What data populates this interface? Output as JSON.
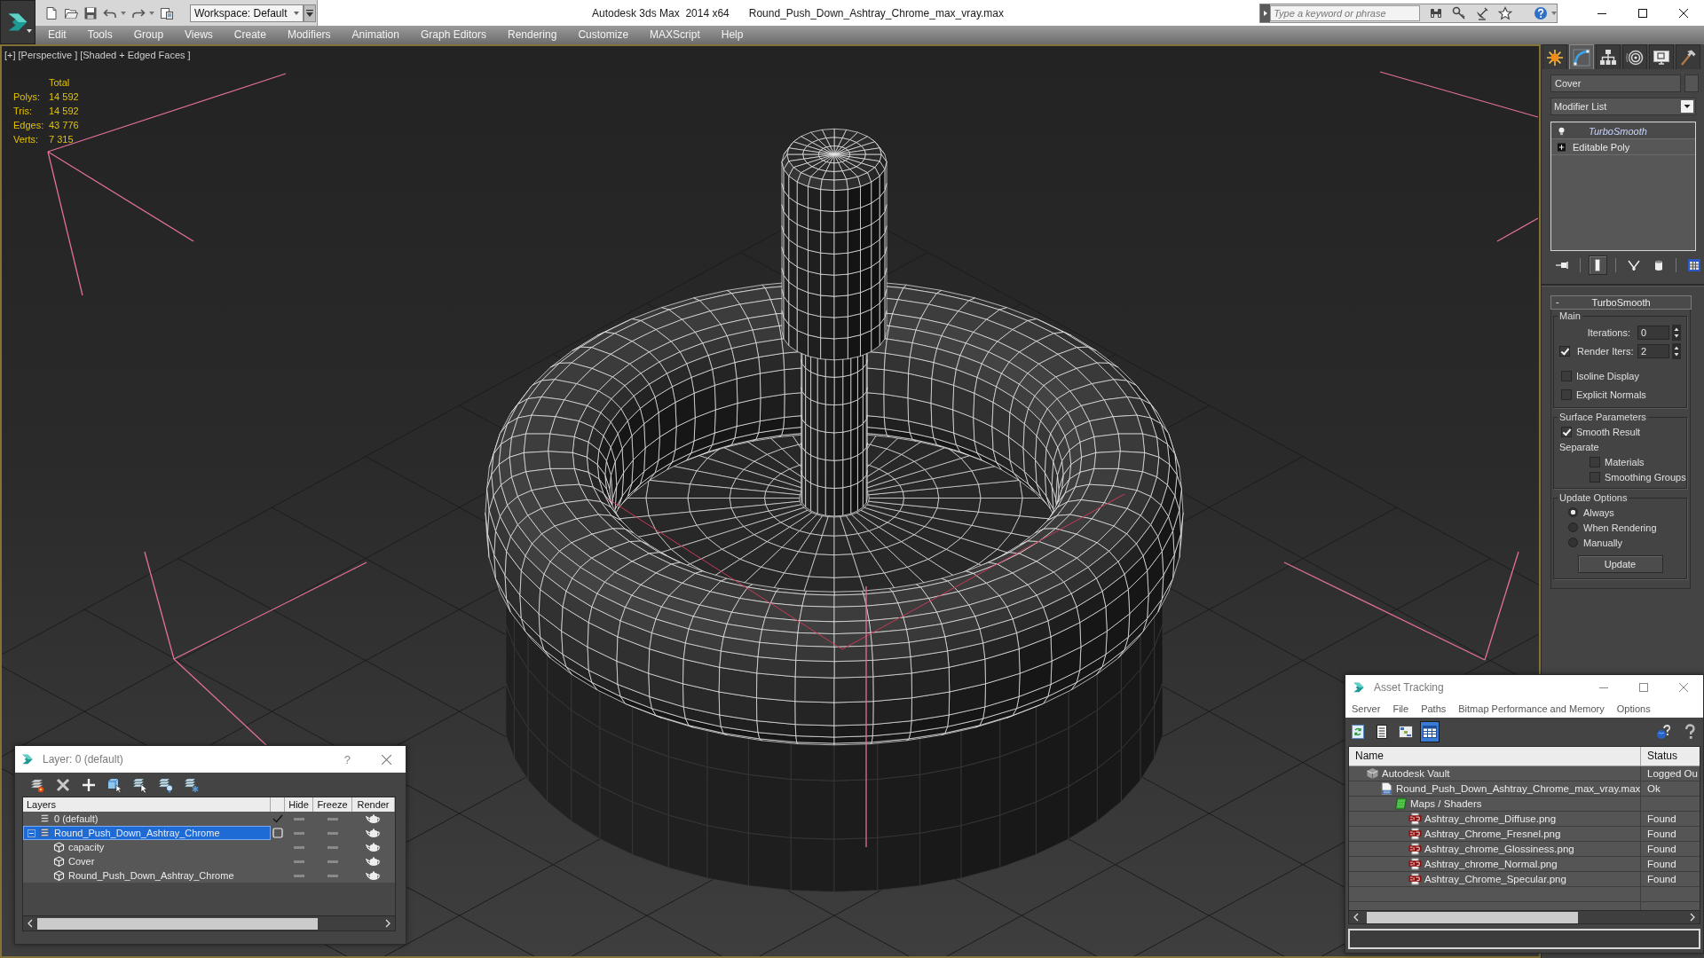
{
  "window": {
    "app_title": "Autodesk 3ds Max  2014 x64",
    "file_title": "Round_Push_Down_Ashtray_Chrome_max_vray.max"
  },
  "toolbar": {
    "workspace": "Workspace: Default"
  },
  "search": {
    "placeholder": "Type a keyword or phrase"
  },
  "menu": [
    "Edit",
    "Tools",
    "Group",
    "Views",
    "Create",
    "Modifiers",
    "Animation",
    "Graph Editors",
    "Rendering",
    "Customize",
    "MAXScript",
    "Help"
  ],
  "viewport": {
    "labels": [
      "[+]",
      "[Perspective ]",
      "[Shaded + Edged Faces ]"
    ],
    "stats": {
      "header": "Total",
      "rows": [
        {
          "label": "Polys:",
          "value": "14 592"
        },
        {
          "label": "Tris:",
          "value": "14 592"
        },
        {
          "label": "Edges:",
          "value": "43 776"
        },
        {
          "label": "Verts:",
          "value": "7 315"
        }
      ]
    }
  },
  "command_panel": {
    "tabs": [
      {
        "selected": false
      },
      {
        "selected": true
      },
      {
        "selected": false
      },
      {
        "selected": false
      },
      {
        "selected": false
      },
      {
        "selected": false
      }
    ],
    "object_name": "Cover",
    "modifier_list": "Modifier List",
    "stack": [
      {
        "kind": "modifier",
        "name": "TurboSmooth",
        "selected": true
      },
      {
        "kind": "object",
        "name": "Editable Poly",
        "selected": false
      }
    ],
    "stack_tools": [
      {
        "selected": false
      },
      {
        "selected": true
      },
      {
        "selected": false
      },
      {
        "selected": false
      },
      {
        "selected": false
      }
    ],
    "rollout": {
      "collapse_sign": "-",
      "title": "TurboSmooth",
      "groups": [
        {
          "title": "Main",
          "controls": [
            {
              "kind": "spinner",
              "label": "Iterations:",
              "value": "0"
            },
            {
              "kind": "checked_spinner",
              "label": "Render Iters:",
              "value": "2",
              "checked": true
            },
            {
              "kind": "checkbox",
              "label": "Isoline Display",
              "checked": false
            },
            {
              "kind": "checkbox",
              "label": "Explicit Normals",
              "checked": false
            }
          ]
        },
        {
          "title": "Surface Parameters",
          "controls": [
            {
              "kind": "checkbox",
              "label": "Smooth Result",
              "checked": true
            },
            {
              "kind": "label",
              "label": "Separate",
              "children": [
                {
                  "kind": "checkbox",
                  "label": "Materials",
                  "checked": false
                },
                {
                  "kind": "checkbox",
                  "label": "Smoothing Groups",
                  "checked": false
                }
              ]
            }
          ]
        },
        {
          "title": "Update Options",
          "controls": [
            {
              "kind": "radio",
              "label": "Always",
              "selected": true
            },
            {
              "kind": "radio",
              "label": "When Rendering",
              "selected": false
            },
            {
              "kind": "radio",
              "label": "Manually",
              "selected": false
            },
            {
              "kind": "button",
              "label": "Update"
            }
          ]
        }
      ]
    }
  },
  "layer_dialog": {
    "title": "Layer: 0 (default)",
    "help": "?",
    "columns": [
      "Layers",
      "Hide",
      "Freeze",
      "Render"
    ],
    "layers": [
      {
        "name": "0 (default)",
        "current": true,
        "selected": false,
        "hidden": false,
        "frozen": false,
        "renderable": true
      },
      {
        "name": "Round_Push_Down_Ashtray_Chrome",
        "current": false,
        "selected": true,
        "expanded": true,
        "hidden": false,
        "frozen": false,
        "renderable": true,
        "children": [
          {
            "name": "capacity",
            "selected": false,
            "hidden": false,
            "frozen": false,
            "renderable": true
          },
          {
            "name": "Cover",
            "selected": false,
            "hidden": false,
            "frozen": false,
            "renderable": true
          },
          {
            "name": "Round_Push_Down_Ashtray_Chrome",
            "selected": false,
            "hidden": false,
            "frozen": false,
            "renderable": true
          }
        ]
      }
    ]
  },
  "asset_tracking": {
    "title": "Asset Tracking",
    "menu": [
      "Server",
      "File",
      "Paths",
      "Bitmap Performance and Memory",
      "Options"
    ],
    "toolbar": [
      {
        "selected": false
      },
      {
        "selected": false
      },
      {
        "selected": false
      },
      {
        "selected": true
      }
    ],
    "columns": [
      "Name",
      "Status"
    ],
    "rows": [
      {
        "kind": "vault",
        "name": "Autodesk Vault",
        "status": "Logged Ou",
        "selected": false,
        "children": [
          {
            "kind": "scene",
            "name": "Round_Push_Down_Ashtray_Chrome_max_vray.max",
            "status": "Ok",
            "selected": false,
            "children": [
              {
                "kind": "folder",
                "name": "Maps / Shaders",
                "selected": false,
                "children": [
                  {
                    "kind": "bitmap",
                    "name": "Ashtray_chrome_Diffuse.png",
                    "status": "Found",
                    "selected": false
                  },
                  {
                    "kind": "bitmap",
                    "name": "Ashtray_Chrome_Fresnel.png",
                    "status": "Found",
                    "selected": false
                  },
                  {
                    "kind": "bitmap",
                    "name": "Ashtray_chrome_Glossiness.png",
                    "status": "Found",
                    "selected": false
                  },
                  {
                    "kind": "bitmap",
                    "name": "Ashtray_chrome_Normal.png",
                    "status": "Found",
                    "selected": false
                  },
                  {
                    "kind": "bitmap",
                    "name": "Ashtray_Chrome_Specular.png",
                    "status": "Found",
                    "selected": false
                  }
                ]
              }
            ]
          }
        ]
      }
    ]
  }
}
